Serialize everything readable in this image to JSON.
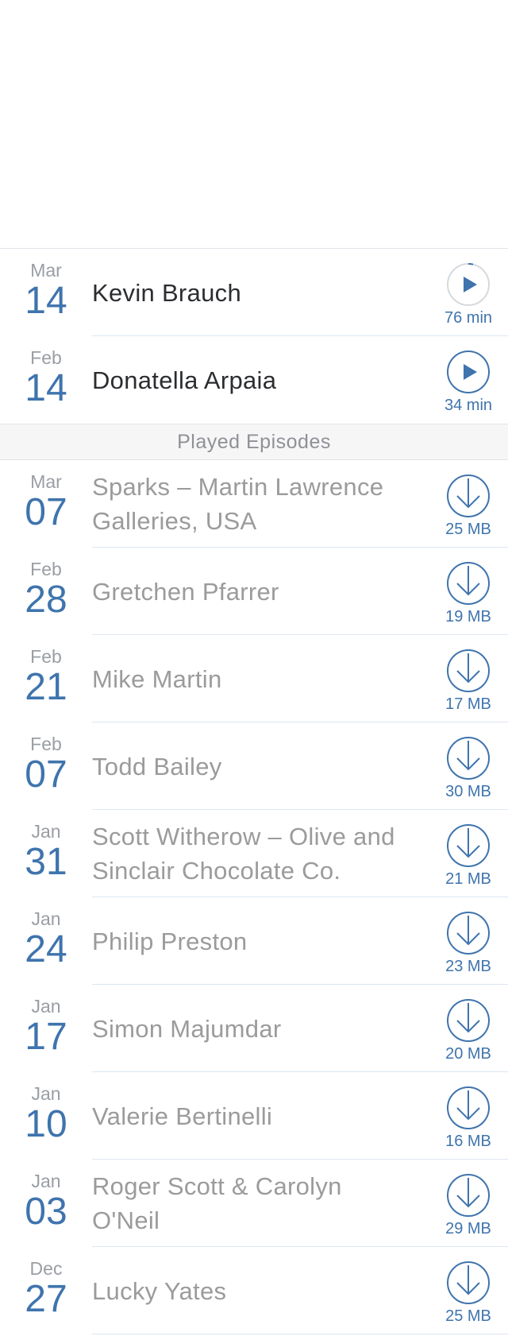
{
  "unplayed": [
    {
      "month": "Mar",
      "day": "14",
      "title": "Kevin Brauch",
      "meta": "76 min"
    },
    {
      "month": "Feb",
      "day": "14",
      "title": "Donatella Arpaia",
      "meta": "34 min"
    }
  ],
  "section_header": "Played Episodes",
  "played": [
    {
      "month": "Mar",
      "day": "07",
      "title": "Sparks – Martin Lawrence Galleries, USA",
      "meta": "25 MB"
    },
    {
      "month": "Feb",
      "day": "28",
      "title": "Gretchen Pfarrer",
      "meta": "19 MB"
    },
    {
      "month": "Feb",
      "day": "21",
      "title": "Mike Martin",
      "meta": "17 MB"
    },
    {
      "month": "Feb",
      "day": "07",
      "title": "Todd Bailey",
      "meta": "30 MB"
    },
    {
      "month": "Jan",
      "day": "31",
      "title": "Scott Witherow – Olive and Sinclair Chocolate Co.",
      "meta": "21 MB"
    },
    {
      "month": "Jan",
      "day": "24",
      "title": "Philip Preston",
      "meta": "23 MB"
    },
    {
      "month": "Jan",
      "day": "17",
      "title": "Simon Majumdar",
      "meta": "20 MB"
    },
    {
      "month": "Jan",
      "day": "10",
      "title": "Valerie Bertinelli",
      "meta": "16 MB"
    },
    {
      "month": "Jan",
      "day": "03",
      "title": "Roger Scott & Carolyn O'Neil",
      "meta": "29 MB"
    },
    {
      "month": "Dec",
      "day": "27",
      "title": "Lucky Yates",
      "meta": "25 MB"
    }
  ],
  "icons": {
    "play": "play-icon",
    "download": "download-icon"
  },
  "colors": {
    "accent": "#3f74ad",
    "played_text": "#9b9b9b",
    "unplayed_text": "#2b2d31"
  }
}
